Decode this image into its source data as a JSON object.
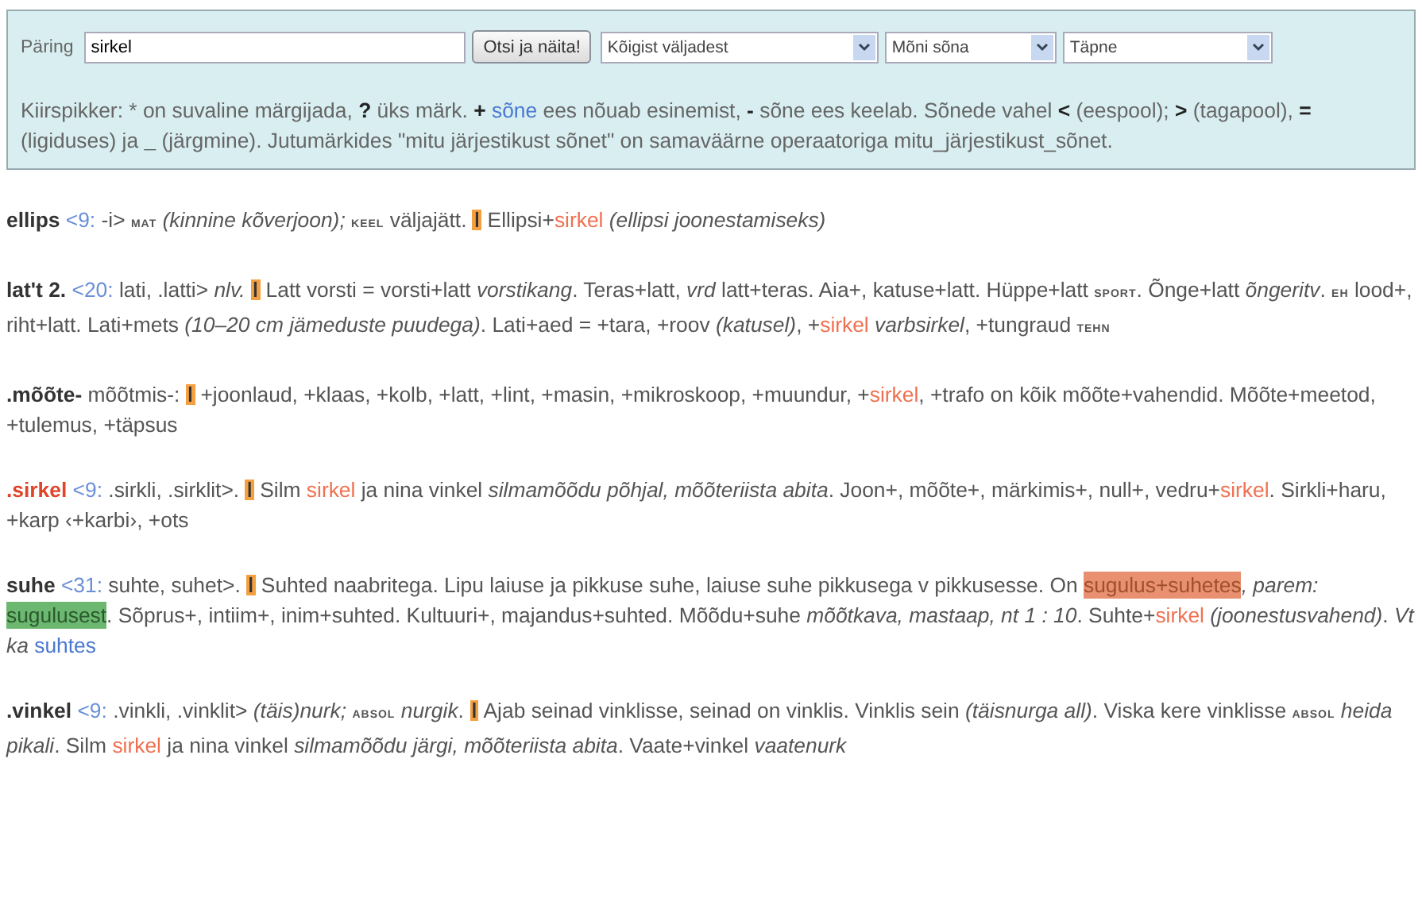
{
  "search": {
    "label": "Päring",
    "value": "sirkel",
    "button": "Otsi ja näita!",
    "selects": [
      {
        "value": "Kõigist väljadest"
      },
      {
        "value": "Mõni sõna"
      },
      {
        "value": "Täpne"
      }
    ],
    "help": [
      {
        "kind": "plain",
        "text": "Kiirspikker: * on suvaline märgijada, "
      },
      {
        "kind": "bold",
        "text": "?"
      },
      {
        "kind": "plain",
        "text": " üks märk. "
      },
      {
        "kind": "bold",
        "text": "+ "
      },
      {
        "kind": "link",
        "text": "sõne"
      },
      {
        "kind": "plain",
        "text": " ees nõuab esinemist, "
      },
      {
        "kind": "bold",
        "text": "-"
      },
      {
        "kind": "plain",
        "text": " sõne ees keelab. Sõnede vahel "
      },
      {
        "kind": "bold",
        "text": "<"
      },
      {
        "kind": "plain",
        "text": " (eespool); "
      },
      {
        "kind": "bold",
        "text": ">"
      },
      {
        "kind": "plain",
        "text": " (tagapool), "
      },
      {
        "kind": "bold",
        "text": "="
      },
      {
        "kind": "plain",
        "text": " (ligiduses) ja "
      },
      {
        "kind": "bold",
        "text": "_"
      },
      {
        "kind": "plain",
        "text": " (järgmine). Jutumärkides \"mitu järjestikust sõnet\" on samaväärne operaatoriga mitu_järjestikust_sõnet."
      }
    ]
  },
  "entries": [
    {
      "segments": [
        {
          "kind": "head",
          "text": "ellips "
        },
        {
          "kind": "ref",
          "text": "<9:"
        },
        {
          "kind": "plain",
          "text": " -i> "
        },
        {
          "kind": "label",
          "text": "MAT"
        },
        {
          "kind": "italic",
          "text": " (kinnine kõverjoon); "
        },
        {
          "kind": "label",
          "text": "KEEL"
        },
        {
          "kind": "plain",
          "text": " väljajätt. "
        },
        {
          "kind": "marker",
          "text": "ǀ"
        },
        {
          "kind": "plain",
          "text": " Ellipsi+"
        },
        {
          "kind": "hit",
          "text": "sirkel"
        },
        {
          "kind": "italic",
          "text": " (ellipsi joonestamiseks)"
        }
      ]
    },
    {
      "segments": [
        {
          "kind": "head",
          "text": "lat't 2. "
        },
        {
          "kind": "ref",
          "text": "<20:"
        },
        {
          "kind": "plain",
          "text": " lati, .latti> "
        },
        {
          "kind": "italic",
          "text": "nlv. "
        },
        {
          "kind": "marker",
          "text": "ǀ"
        },
        {
          "kind": "plain",
          "text": " Latt vorsti = vorsti+latt "
        },
        {
          "kind": "italic",
          "text": "vorstikang"
        },
        {
          "kind": "plain",
          "text": ". Teras+latt, "
        },
        {
          "kind": "italic",
          "text": "vrd"
        },
        {
          "kind": "plain",
          "text": " latt+teras. Aia+, katuse+latt. Hüppe+latt "
        },
        {
          "kind": "label",
          "text": "SPORT"
        },
        {
          "kind": "plain",
          "text": ". Õnge+latt "
        },
        {
          "kind": "italic",
          "text": "õngeritv"
        },
        {
          "kind": "plain",
          "text": ". "
        },
        {
          "kind": "label",
          "text": "EH"
        },
        {
          "kind": "plain",
          "text": " lood+, riht+latt. Lati+mets "
        },
        {
          "kind": "italic",
          "text": "(10–20 cm jämeduste puudega)"
        },
        {
          "kind": "plain",
          "text": ". Lati+aed = +tara, +roov "
        },
        {
          "kind": "italic",
          "text": "(katusel)"
        },
        {
          "kind": "plain",
          "text": ", +"
        },
        {
          "kind": "hit",
          "text": "sirkel"
        },
        {
          "kind": "italic",
          "text": " varbsirkel"
        },
        {
          "kind": "plain",
          "text": ", +tungraud "
        },
        {
          "kind": "label",
          "text": "TEHN"
        }
      ]
    },
    {
      "segments": [
        {
          "kind": "head",
          "text": ".mõõte-"
        },
        {
          "kind": "plain",
          "text": " mõõtmis-: "
        },
        {
          "kind": "marker",
          "text": "ǀ"
        },
        {
          "kind": "plain",
          "text": " +joonlaud, +klaas, +kolb, +latt, +lint, +masin, +mikroskoop, +muundur, +"
        },
        {
          "kind": "hit",
          "text": "sirkel"
        },
        {
          "kind": "plain",
          "text": ", +trafo on kõik mõõte+vahendid. Mõõte+meetod, +tulemus, +täpsus"
        }
      ]
    },
    {
      "segments": [
        {
          "kind": "hithead",
          "text": ".sirkel "
        },
        {
          "kind": "ref",
          "text": "<9:"
        },
        {
          "kind": "plain",
          "text": " .sirkli, .sirklit>. "
        },
        {
          "kind": "marker",
          "text": "ǀ"
        },
        {
          "kind": "plain",
          "text": " Silm "
        },
        {
          "kind": "hit",
          "text": "sirkel"
        },
        {
          "kind": "plain",
          "text": " ja nina vinkel "
        },
        {
          "kind": "italic",
          "text": "silmamõõdu põhjal, mõõteriista abita"
        },
        {
          "kind": "plain",
          "text": ". Joon+, mõõte+, märkimis+, null+, vedru+"
        },
        {
          "kind": "hit",
          "text": "sirkel"
        },
        {
          "kind": "plain",
          "text": ". Sirkli+haru, +karp ‹+karbi›, +ots"
        }
      ]
    },
    {
      "segments": [
        {
          "kind": "head",
          "text": "suhe "
        },
        {
          "kind": "ref",
          "text": "<31:"
        },
        {
          "kind": "plain",
          "text": " suhte, suhet>. "
        },
        {
          "kind": "marker",
          "text": "ǀ"
        },
        {
          "kind": "plain",
          "text": " Suhted naabritega. Lipu laiuse ja pikkuse suhe, laiuse suhe pikkusega v pikkusesse. On "
        },
        {
          "kind": "highlight",
          "text": "sugulus+suhetes"
        },
        {
          "kind": "italic",
          "text": ", parem: "
        },
        {
          "kind": "good",
          "text": "sugulusest"
        },
        {
          "kind": "plain",
          "text": ". Sõprus+, intiim+, inim+suhted. Kultuuri+, majandus+suhted. Mõõdu+suhe "
        },
        {
          "kind": "italic",
          "text": "mõõtkava, mastaap, nt 1 : 10"
        },
        {
          "kind": "plain",
          "text": ". Suhte+"
        },
        {
          "kind": "hit",
          "text": "sirkel"
        },
        {
          "kind": "italic",
          "text": " (joonestusvahend)"
        },
        {
          "kind": "plain",
          "text": ". "
        },
        {
          "kind": "italic",
          "text": "Vt ka "
        },
        {
          "kind": "link",
          "text": "suhtes"
        }
      ]
    },
    {
      "segments": [
        {
          "kind": "head",
          "text": ".vinkel "
        },
        {
          "kind": "ref",
          "text": "<9:"
        },
        {
          "kind": "plain",
          "text": " .vinkli, .vinklit> "
        },
        {
          "kind": "italic",
          "text": "(täis)nurk; "
        },
        {
          "kind": "label",
          "text": "ABSOL"
        },
        {
          "kind": "italic",
          "text": " nurgik"
        },
        {
          "kind": "plain",
          "text": ". "
        },
        {
          "kind": "marker",
          "text": "ǀ"
        },
        {
          "kind": "plain",
          "text": " Ajab seinad vinklisse, seinad on vinklis. Vinklis sein "
        },
        {
          "kind": "italic",
          "text": "(täisnurga all)"
        },
        {
          "kind": "plain",
          "text": ". Viska kere vinklisse "
        },
        {
          "kind": "label",
          "text": "ABSOL"
        },
        {
          "kind": "italic",
          "text": " heida pikali"
        },
        {
          "kind": "plain",
          "text": ". Silm "
        },
        {
          "kind": "hit",
          "text": "sirkel"
        },
        {
          "kind": "plain",
          "text": " ja nina vinkel "
        },
        {
          "kind": "italic",
          "text": "silmamõõdu järgi, mõõteriista abita"
        },
        {
          "kind": "plain",
          "text": ". Vaate+vinkel "
        },
        {
          "kind": "italic",
          "text": "vaatenurk"
        }
      ]
    }
  ]
}
